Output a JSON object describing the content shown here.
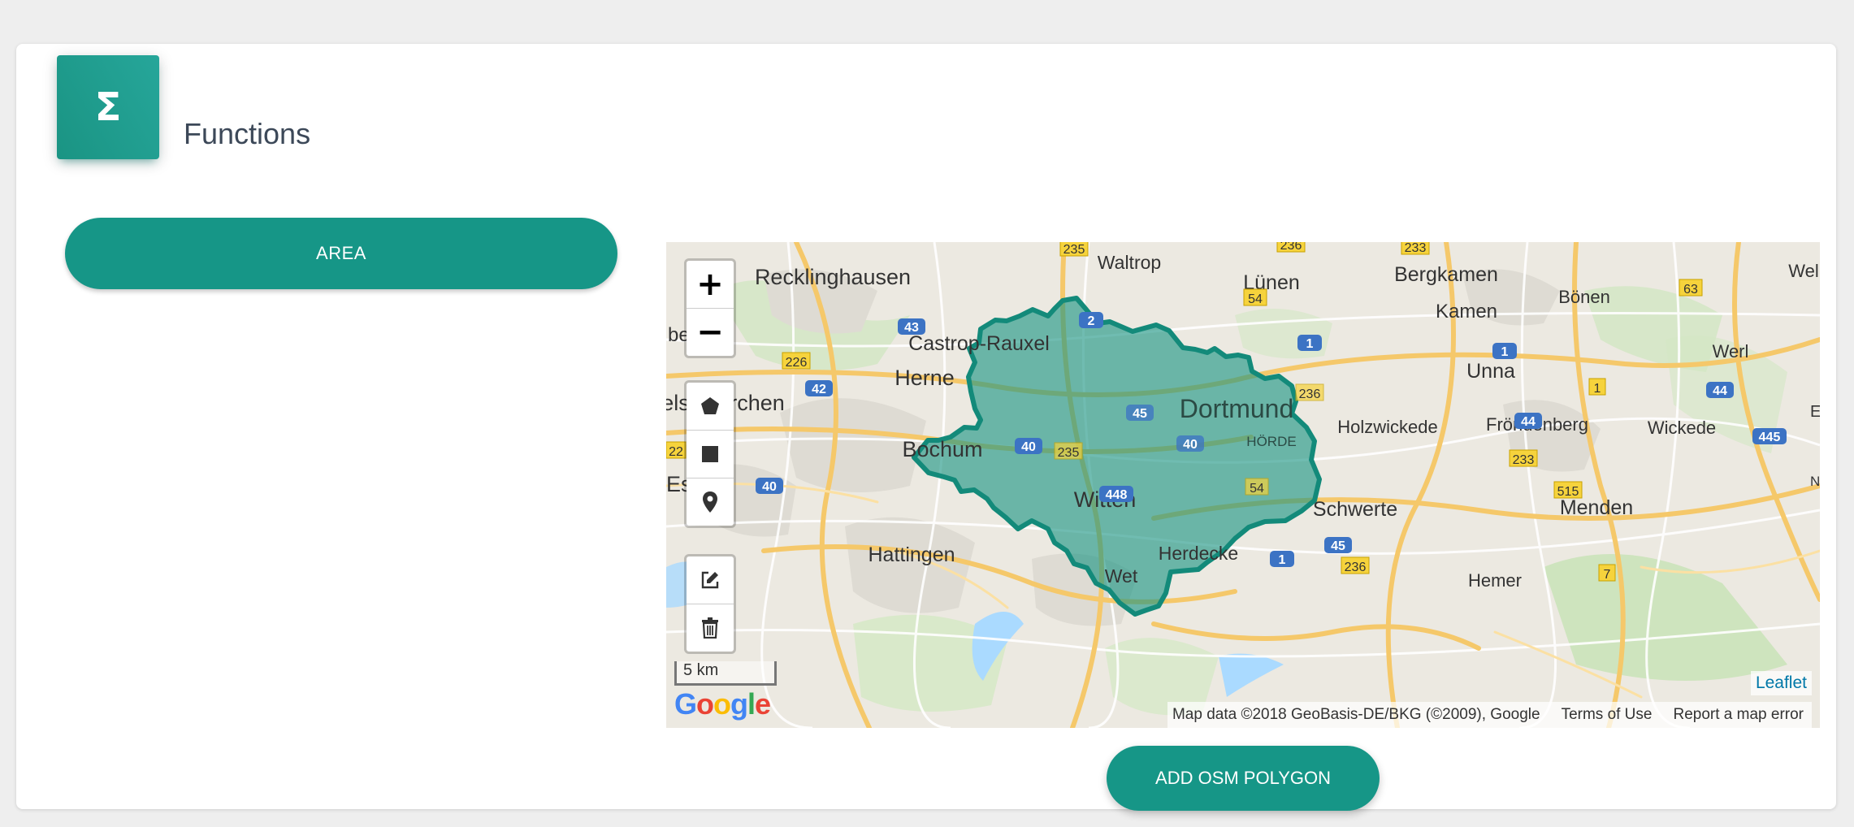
{
  "card": {
    "icon_glyph": "Σ",
    "icon_name": "sigma-icon",
    "title": "Functions"
  },
  "area_button": {
    "label": "AREA"
  },
  "osm_button": {
    "label": "ADD OSM POLYGON"
  },
  "map": {
    "controls": {
      "zoom_in": "+",
      "zoom_out": "−",
      "draw_tools": [
        "polygon-icon",
        "rectangle-icon",
        "marker-icon"
      ],
      "edit_tools": [
        "edit-icon",
        "trash-icon"
      ]
    },
    "scale_label": "5 km",
    "google_logo": "Google",
    "leaflet_label": "Leaflet",
    "attribution": {
      "map_data": "Map data ©2018 GeoBasis-DE/BKG (©2009), Google",
      "terms": "Terms of Use",
      "report": "Report a map error"
    },
    "polygon_fill": "#1a9483",
    "labels": {
      "recklinghausen": "Recklinghausen",
      "waltrop": "Waltrop",
      "luenen": "Lünen",
      "bergkamen": "Bergkamen",
      "wel": "Wel",
      "kamen": "Kamen",
      "boenen": "Bönen",
      "beck": "beck",
      "castrop": "Castrop-Rauxel",
      "werl": "Werl",
      "herne": "Herne",
      "unna": "Unna",
      "gelsenkirchen": "elsenkirchen",
      "dortmund": "Dortmund",
      "holzwickede": "Holzwickede",
      "froendenberg": "Fröndenberg",
      "wickede": "Wickede",
      "e_edge": "E",
      "bochum": "Bochum",
      "hoerde": "HÖRDE",
      "es": "Es",
      "witten": "Witten",
      "schwerte": "Schwerte",
      "menden": "Menden",
      "ne": "NE",
      "hattingen": "Hattingen",
      "herdecke": "Herdecke",
      "wet": "Wet",
      "hemer": "Hemer"
    },
    "shields": {
      "s235a": "235",
      "s236a": "236",
      "s233a": "233",
      "s2": "2",
      "s54a": "54",
      "s63": "63",
      "s43": "43",
      "s226": "226",
      "s1a": "1",
      "s42": "42",
      "s236b": "236",
      "s44a": "44",
      "s1b": "1",
      "s44b": "44",
      "s45a": "45",
      "s235b": "235",
      "s40a": "40",
      "s40b": "40",
      "s445": "445",
      "s22": "22",
      "s233b": "233",
      "s40c": "40",
      "s448": "448",
      "s54b": "54",
      "s515": "515",
      "s1c": "1",
      "s45b": "45",
      "s236c": "236",
      "s7": "7"
    }
  }
}
